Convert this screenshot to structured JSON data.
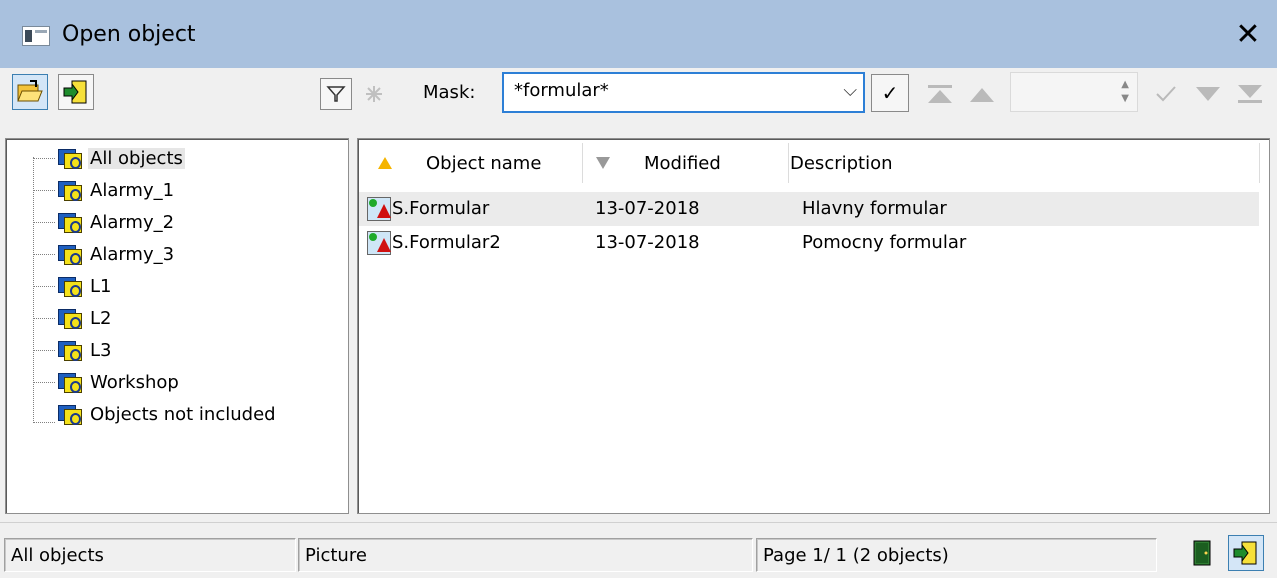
{
  "window": {
    "title": "Open object",
    "close_glyph": "✕",
    "icon": "window-icon"
  },
  "toolbar": {
    "open_button_icon": "open-folder-icon",
    "exit_button_icon": "exit-door-icon",
    "filter_icon": "filter-icon",
    "clear_filter_icon": "clear-filter-icon",
    "mask_label": "Mask:",
    "mask_value": "*formular*",
    "mask_arrow": "⌵",
    "apply_glyph": "✓",
    "first_icon": "first-page-icon",
    "prev_icon": "prev-page-icon",
    "page_input_value": "",
    "confirm_icon": "check-icon",
    "next_icon": "next-page-icon",
    "last_icon": "last-page-icon"
  },
  "tree": {
    "items": [
      {
        "label": "All objects",
        "selected": true
      },
      {
        "label": "Alarmy_1"
      },
      {
        "label": "Alarmy_2"
      },
      {
        "label": "Alarmy_3"
      },
      {
        "label": "L1"
      },
      {
        "label": "L2"
      },
      {
        "label": "L3"
      },
      {
        "label": "Workshop"
      },
      {
        "label": "Objects not included"
      }
    ]
  },
  "list": {
    "columns": [
      {
        "label": "Object name",
        "sort": "asc"
      },
      {
        "label": "Modified",
        "sort": "desc"
      },
      {
        "label": "Description"
      }
    ],
    "rows": [
      {
        "name": "S.Formular",
        "modified": "13-07-2018",
        "description": "Hlavny formular"
      },
      {
        "name": "S.Formular2",
        "modified": "13-07-2018",
        "description": "Pomocny formular"
      }
    ]
  },
  "status": {
    "group": "All objects",
    "type": "Picture",
    "page": "Page  1/ 1   (2 objects)",
    "colors": {
      "accent": "#2d7fd6",
      "titlebar": "#a9c1de"
    }
  }
}
